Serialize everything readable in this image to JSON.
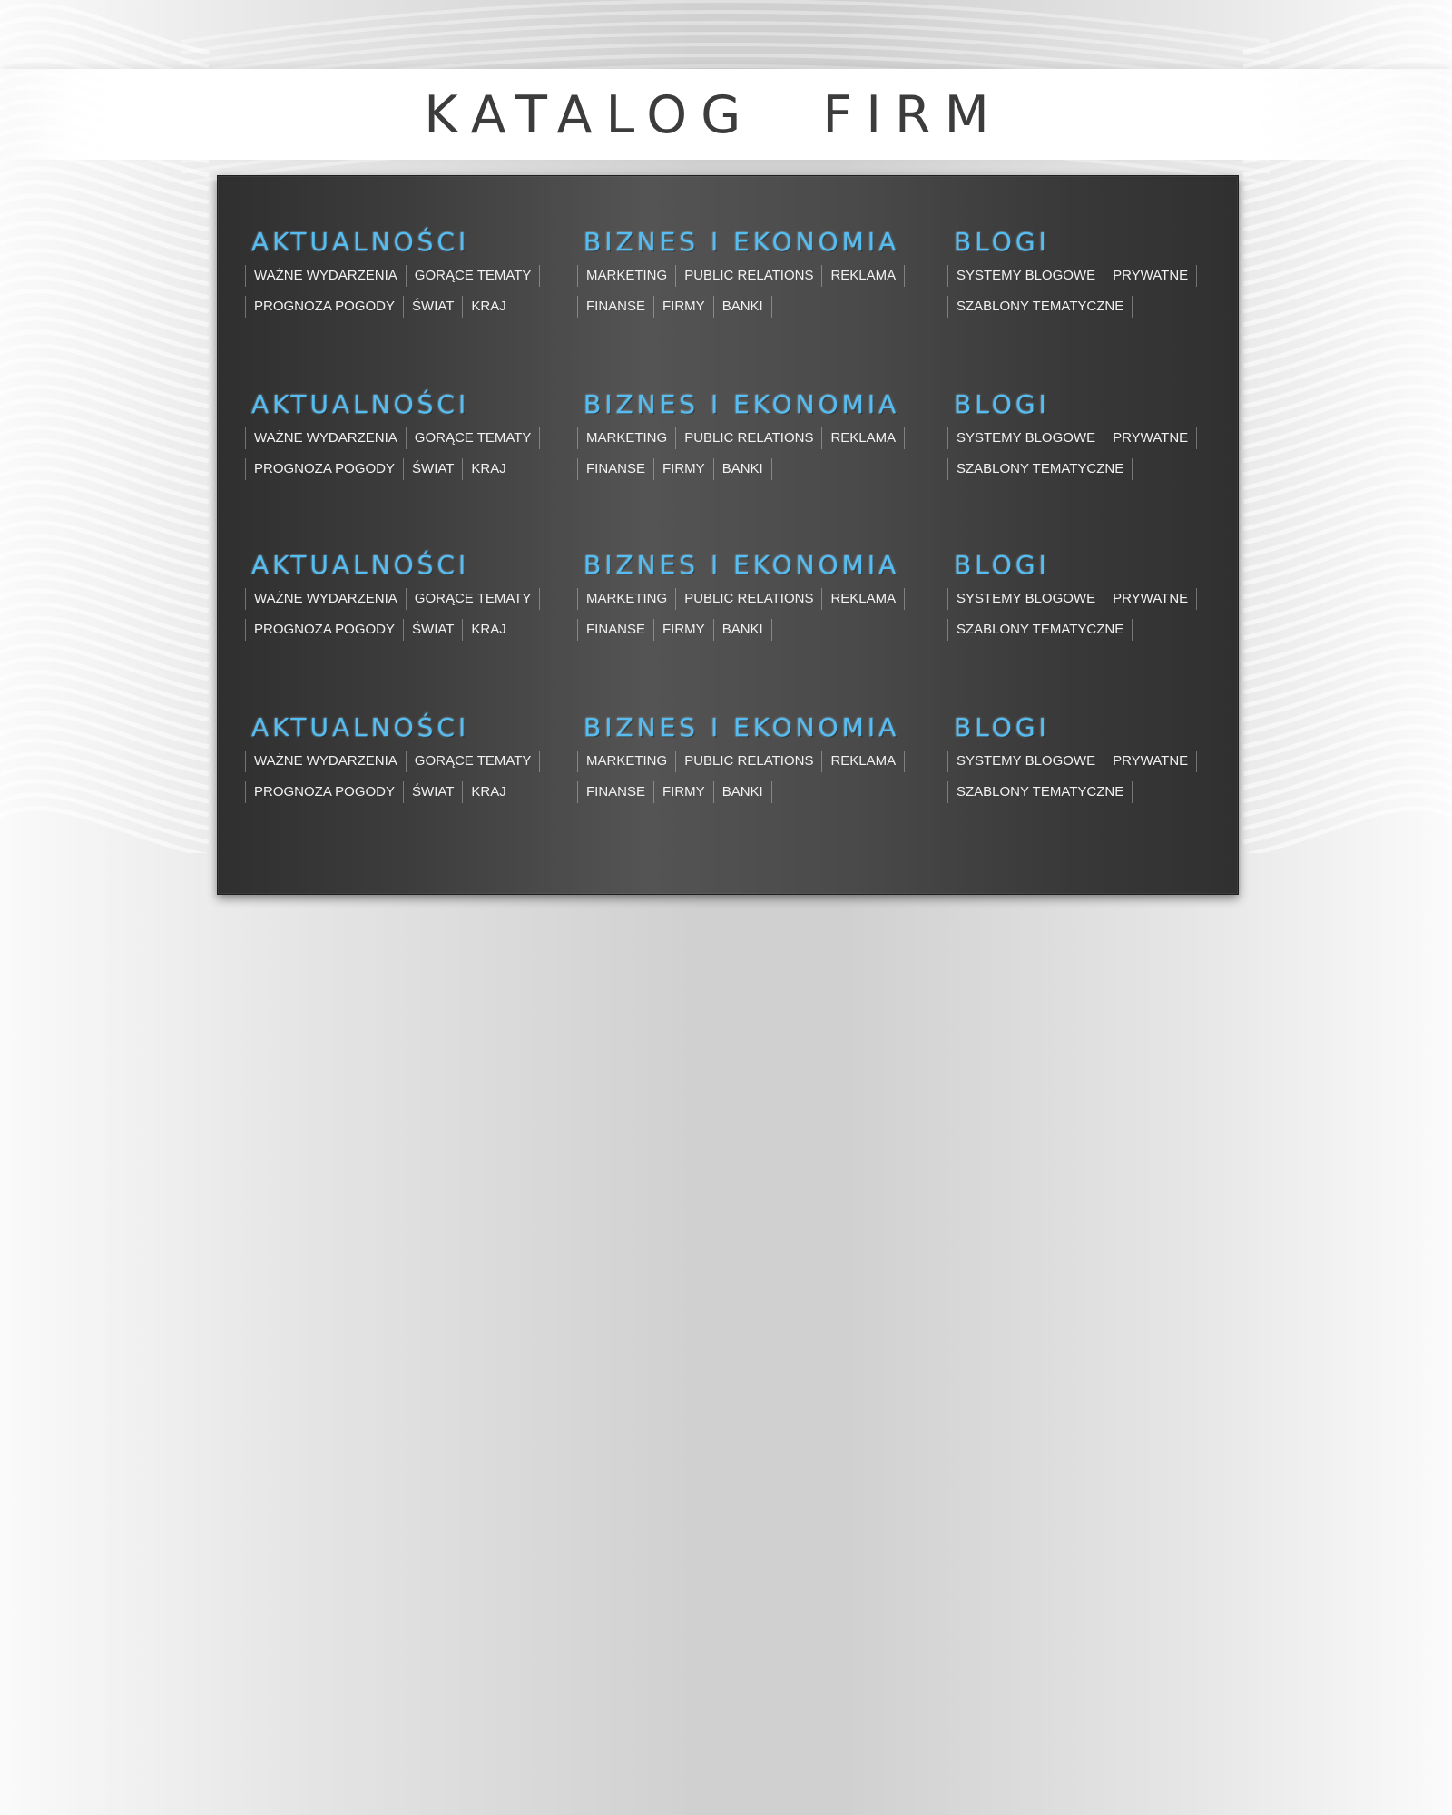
{
  "header": {
    "title": "KATALOG FIRM"
  },
  "catalog": {
    "rows": [
      {
        "columns": [
          {
            "title": "AKTUALNOŚCI",
            "lines": [
              [
                "WAŻNE WYDARZENIA",
                "GORĄCE TEMATY"
              ],
              [
                "PROGNOZA POGODY",
                "ŚWIAT",
                "KRAJ"
              ]
            ]
          },
          {
            "title": "BIZNES I EKONOMIA",
            "lines": [
              [
                "MARKETING",
                "PUBLIC RELATIONS",
                "REKLAMA"
              ],
              [
                "FINANSE",
                "FIRMY",
                "BANKI"
              ]
            ]
          },
          {
            "title": "BLOGI",
            "lines": [
              [
                "SYSTEMY BLOGOWE",
                "PRYWATNE"
              ],
              [
                "SZABLONY TEMATYCZNE"
              ]
            ]
          }
        ]
      },
      {
        "columns": [
          {
            "title": "AKTUALNOŚCI",
            "lines": [
              [
                "WAŻNE WYDARZENIA",
                "GORĄCE TEMATY"
              ],
              [
                "PROGNOZA POGODY",
                "ŚWIAT",
                "KRAJ"
              ]
            ]
          },
          {
            "title": "BIZNES I EKONOMIA",
            "lines": [
              [
                "MARKETING",
                "PUBLIC RELATIONS",
                "REKLAMA"
              ],
              [
                "FINANSE",
                "FIRMY",
                "BANKI"
              ]
            ]
          },
          {
            "title": "BLOGI",
            "lines": [
              [
                "SYSTEMY BLOGOWE",
                "PRYWATNE"
              ],
              [
                "SZABLONY TEMATYCZNE"
              ]
            ]
          }
        ]
      },
      {
        "columns": [
          {
            "title": "AKTUALNOŚCI",
            "lines": [
              [
                "WAŻNE WYDARZENIA",
                "GORĄCE TEMATY"
              ],
              [
                "PROGNOZA POGODY",
                "ŚWIAT",
                "KRAJ"
              ]
            ]
          },
          {
            "title": "BIZNES I EKONOMIA",
            "lines": [
              [
                "MARKETING",
                "PUBLIC RELATIONS",
                "REKLAMA"
              ],
              [
                "FINANSE",
                "FIRMY",
                "BANKI"
              ]
            ]
          },
          {
            "title": "BLOGI",
            "lines": [
              [
                "SYSTEMY BLOGOWE",
                "PRYWATNE"
              ],
              [
                "SZABLONY TEMATYCZNE"
              ]
            ]
          }
        ]
      },
      {
        "columns": [
          {
            "title": "AKTUALNOŚCI",
            "lines": [
              [
                "WAŻNE WYDARZENIA",
                "GORĄCE TEMATY"
              ],
              [
                "PROGNOZA POGODY",
                "ŚWIAT",
                "KRAJ"
              ]
            ]
          },
          {
            "title": "BIZNES I EKONOMIA",
            "lines": [
              [
                "MARKETING",
                "PUBLIC RELATIONS",
                "REKLAMA"
              ],
              [
                "FINANSE",
                "FIRMY",
                "BANKI"
              ]
            ]
          },
          {
            "title": "BLOGI",
            "lines": [
              [
                "SYSTEMY BLOGOWE",
                "PRYWATNE"
              ],
              [
                "SZABLONY TEMATYCZNE"
              ]
            ]
          }
        ]
      }
    ]
  },
  "colors": {
    "accent": "#55bdf2",
    "panel": "#3c3c3c",
    "title": "#3c3c3c",
    "tag_text": "#f2f2f2"
  }
}
